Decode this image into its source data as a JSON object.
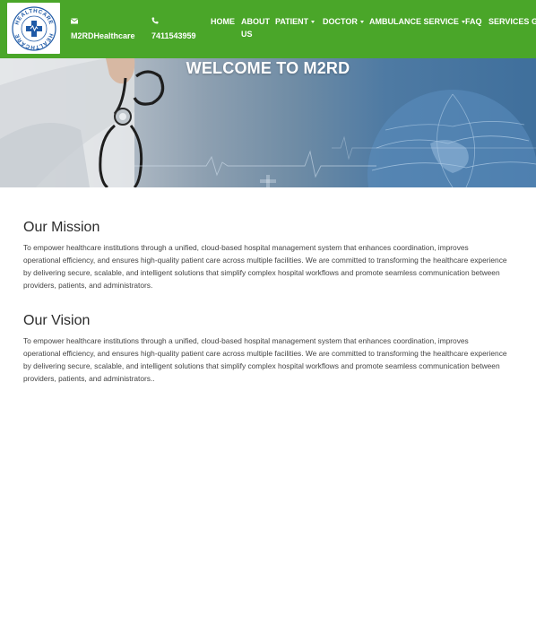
{
  "header": {
    "logo_text": "HEALTHCARE",
    "email_icon": "envelope-icon",
    "email": "M2RDHealthcare",
    "phone_icon": "phone-icon",
    "phone": "7411543959",
    "nav": [
      {
        "label": "HOME"
      },
      {
        "label": "ABOUT",
        "label2": "US"
      },
      {
        "label": "PATIENT",
        "dropdown": true
      },
      {
        "label": "DOCTOR",
        "dropdown": true
      },
      {
        "label": "AMBULANCE SERVICE",
        "dropdown": true
      },
      {
        "label": "FAQ"
      },
      {
        "label": "SERVICES"
      },
      {
        "label": "G"
      }
    ]
  },
  "hero": {
    "title": "WELCOME TO M2RD"
  },
  "mission": {
    "heading": "Our Mission",
    "text": "To empower healthcare institutions through a unified, cloud-based hospital management system that enhances coordination, improves operational efficiency, and ensures high-quality patient care across multiple facilities. We are committed to transforming the healthcare experience by delivering secure, scalable, and intelligent solutions that simplify complex hospital workflows and promote seamless communication between providers, patients, and administrators."
  },
  "vision": {
    "heading": "Our Vision",
    "text": "To empower healthcare institutions through a unified, cloud-based hospital management system that enhances coordination, improves operational efficiency, and ensures high-quality patient care across multiple facilities. We are committed to transforming the healthcare experience by delivering secure, scalable, and intelligent solutions that simplify complex hospital workflows and promote seamless communication between providers, patients, and administrators.."
  },
  "colors": {
    "header_bg": "#4aa629",
    "logo_blue": "#1f5aa6",
    "text": "#444444"
  }
}
